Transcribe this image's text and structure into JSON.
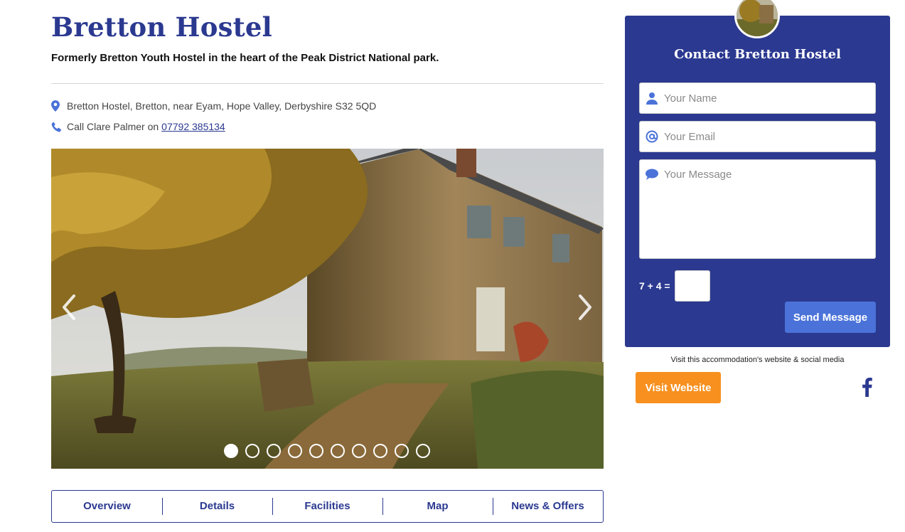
{
  "hostel": {
    "name": "Bretton Hostel",
    "tagline": "Formerly Bretton Youth Hostel in the heart of the Peak District National park.",
    "address": "Bretton Hostel, Bretton, near Eyam, Hope Valley, Derbyshire S32 5QD",
    "call_prefix": "Call Clare Palmer on",
    "phone": "07792 385134"
  },
  "carousel": {
    "slide_count": 10,
    "active_index": 0
  },
  "tabs": [
    {
      "label": "Overview"
    },
    {
      "label": "Details"
    },
    {
      "label": "Facilities"
    },
    {
      "label": "Map"
    },
    {
      "label": "News & Offers"
    }
  ],
  "contact": {
    "title": "Contact Bretton Hostel",
    "name_placeholder": "Your Name",
    "email_placeholder": "Your Email",
    "message_placeholder": "Your Message",
    "captcha_label": "7 + 4 =",
    "send_label": "Send Message"
  },
  "social": {
    "note": "Visit this accommodation's website & social media",
    "visit_label": "Visit Website"
  },
  "colors": {
    "brand_blue": "#2b3990",
    "button_blue": "#4a72d9",
    "orange": "#f7901e"
  },
  "icons": [
    "location-pin-icon",
    "phone-icon",
    "user-icon",
    "at-icon",
    "speech-bubble-icon",
    "chevron-left-icon",
    "chevron-right-icon",
    "facebook-icon"
  ]
}
